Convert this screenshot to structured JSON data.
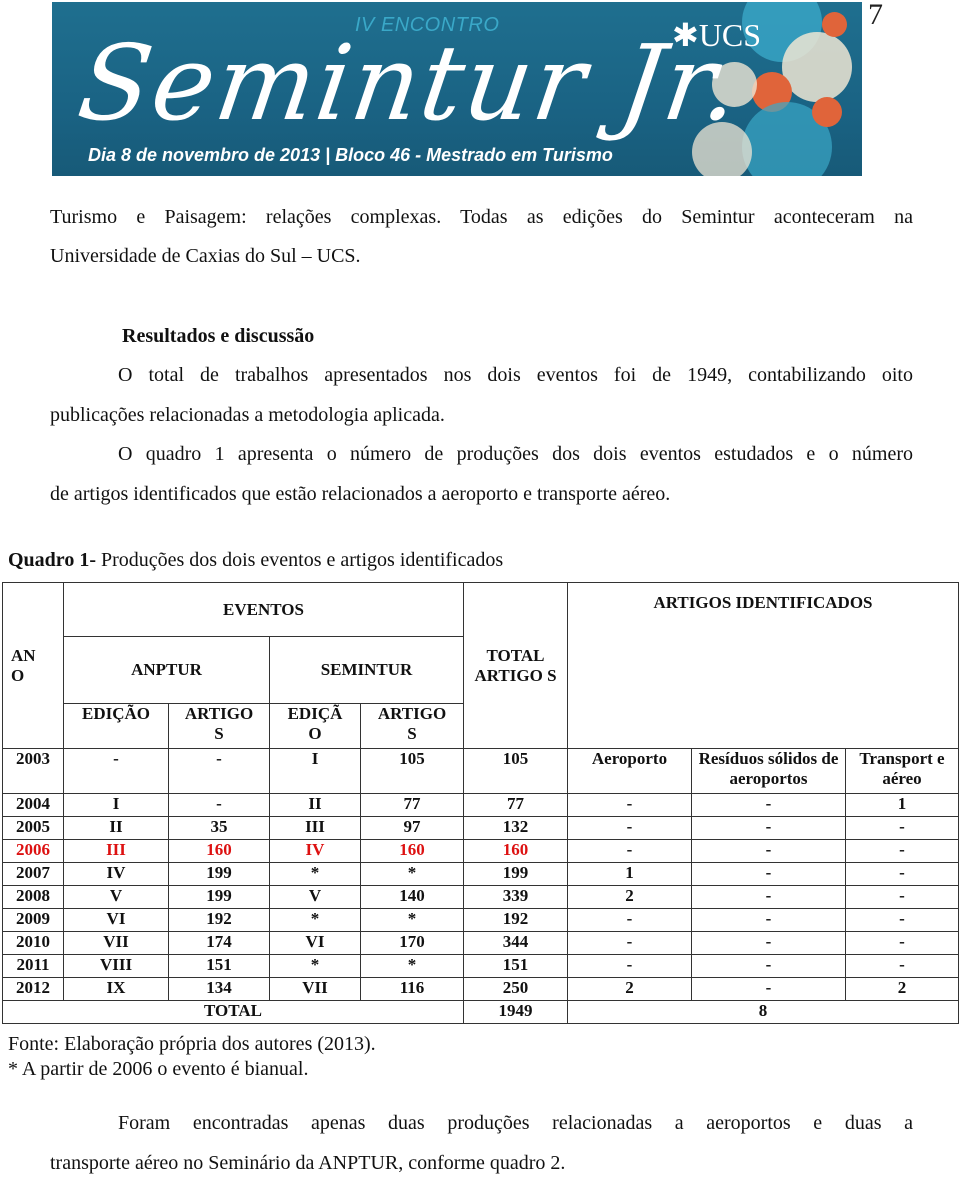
{
  "page_number": "7",
  "banner": {
    "encontro": "IV ENCONTRO",
    "title": "Semintur Jr.",
    "institution": "UCS",
    "subtitle": "Dia 8 de novembro de 2013 | Bloco 46 - Mestrado em Turismo",
    "colors": {
      "background": "#1a6384",
      "accent_blue": "#3aa8c8",
      "accent_orange": "#e0643a",
      "cream": "#efe6d4"
    }
  },
  "paragraphs": {
    "intro_line1": "Turismo e Paisagem: relações complexas. Todas as edições do Semintur aconteceram na",
    "intro_line2": "Universidade de Caxias do Sul – UCS.",
    "section_heading": "Resultados e discussão",
    "p1_line1": "O total de trabalhos apresentados nos dois eventos foi de 1949, contabilizando oito",
    "p1_line2": "publicações relacionadas a metodologia aplicada.",
    "p2_line1": "O quadro 1 apresenta o número de produções dos dois eventos estudados e o número",
    "p2_line2": "de artigos identificados que estão relacionados a aeroporto e transporte aéreo.",
    "final_line1": "Foram encontradas apenas duas produções relacionadas a aeroportos e duas a",
    "final_line2": "transporte aéreo no Seminário da ANPTUR, conforme quadro 2."
  },
  "quadro": {
    "caption_bold": "Quadro 1-",
    "caption_text": " Produções dos dois eventos e artigos identificados",
    "headers": {
      "ano": "AN O",
      "eventos": "EVENTOS",
      "anptur": "ANPTUR",
      "semintur": "SEMINTUR",
      "total_artigos": "TOTAL ARTIGO S",
      "artigos_identificados": "ARTIGOS IDENTIFICADOS",
      "edicao_anptur": "EDIÇÃO",
      "artigos_anptur": "ARTIGO S",
      "edicao_semintur": "EDIÇÃ O",
      "artigos_semintur": "ARTIGO S"
    },
    "highlight_color": "#d11111",
    "rows": [
      {
        "ano": "2003",
        "ed_anptur": "-",
        "art_anptur": "-",
        "ed_semintur": "I",
        "art_semintur": "105",
        "total": "105",
        "c1": "Aeroporto",
        "c2": "Resíduos sólidos de aeroportos",
        "c3": "Transport e aéreo",
        "highlight": false
      },
      {
        "ano": "2004",
        "ed_anptur": "I",
        "art_anptur": "-",
        "ed_semintur": "II",
        "art_semintur": "77",
        "total": "77",
        "c1": "-",
        "c2": "-",
        "c3": "1",
        "highlight": false
      },
      {
        "ano": "2005",
        "ed_anptur": "II",
        "art_anptur": "35",
        "ed_semintur": "III",
        "art_semintur": "97",
        "total": "132",
        "c1": "-",
        "c2": "-",
        "c3": "-",
        "highlight": false
      },
      {
        "ano": "2006",
        "ed_anptur": "III",
        "art_anptur": "160",
        "ed_semintur": "IV",
        "art_semintur": "160",
        "total": "160",
        "c1": "-",
        "c2": "-",
        "c3": "-",
        "highlight": true
      },
      {
        "ano": "2007",
        "ed_anptur": "IV",
        "art_anptur": "199",
        "ed_semintur": "*",
        "art_semintur": "*",
        "total": "199",
        "c1": "1",
        "c2": "-",
        "c3": "-",
        "highlight": false
      },
      {
        "ano": "2008",
        "ed_anptur": "V",
        "art_anptur": "199",
        "ed_semintur": "V",
        "art_semintur": "140",
        "total": "339",
        "c1": "2",
        "c2": "-",
        "c3": "-",
        "highlight": false
      },
      {
        "ano": "2009",
        "ed_anptur": "VI",
        "art_anptur": "192",
        "ed_semintur": "*",
        "art_semintur": "*",
        "total": "192",
        "c1": "-",
        "c2": "-",
        "c3": "-",
        "highlight": false
      },
      {
        "ano": "2010",
        "ed_anptur": "VII",
        "art_anptur": "174",
        "ed_semintur": "VI",
        "art_semintur": "170",
        "total": "344",
        "c1": "-",
        "c2": "-",
        "c3": "-",
        "highlight": false
      },
      {
        "ano": "2011",
        "ed_anptur": "VIII",
        "art_anptur": "151",
        "ed_semintur": "*",
        "art_semintur": "*",
        "total": "151",
        "c1": "-",
        "c2": "-",
        "c3": "-",
        "highlight": false
      },
      {
        "ano": "2012",
        "ed_anptur": "IX",
        "art_anptur": "134",
        "ed_semintur": "VII",
        "art_semintur": "116",
        "total": "250",
        "c1": "2",
        "c2": "-",
        "c3": "2",
        "highlight": false
      }
    ],
    "total_row": {
      "label": "TOTAL",
      "total": "1949",
      "identified": "8"
    },
    "source": "Fonte: Elaboração própria dos autores (2013).",
    "note": "* A partir de 2006 o evento é bianual."
  }
}
